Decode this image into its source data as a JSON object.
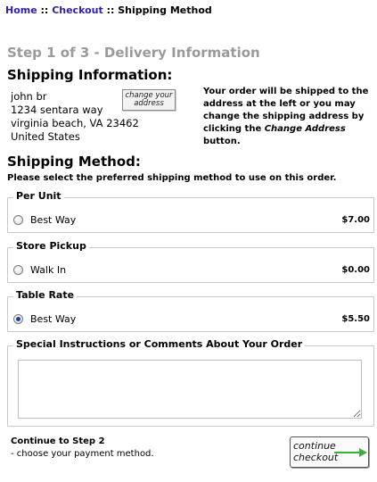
{
  "breadcrumb": {
    "home": "Home",
    "separator_1": "::",
    "checkout": "Checkout",
    "separator_2": "::",
    "current": "Shipping Method"
  },
  "step_title": "Step 1 of 3 - Delivery Information",
  "shipping_info": {
    "heading": "Shipping Information:",
    "address_lines": [
      "john br",
      "1234 sentara way",
      "virginia beach, VA 23462",
      "United States"
    ],
    "change_address_button": {
      "line1": "change your",
      "line2": "address"
    },
    "note_before": "Your order will be shipped to the address at the left or you may change the shipping address by clicking the ",
    "note_emphasis": "Change Address",
    "note_after": " button."
  },
  "shipping_method": {
    "heading": "Shipping Method:",
    "intro": "Please select the preferred shipping method to use on this order.",
    "groups": [
      {
        "title": "Per Unit",
        "option": "Best Way",
        "price": "$7.00",
        "selected": false
      },
      {
        "title": "Store Pickup",
        "option": "Walk In",
        "price": "$0.00",
        "selected": false
      },
      {
        "title": "Table Rate",
        "option": "Best Way",
        "price": "$5.50",
        "selected": true
      }
    ]
  },
  "comments": {
    "legend": "Special Instructions or Comments About Your Order",
    "value": ""
  },
  "footer": {
    "continue_title": "Continue to Step 2",
    "continue_sub": "- choose your payment method.",
    "continue_button": {
      "line1": "continue",
      "line2": "checkout"
    },
    "arrow_color": "#3fae3f"
  },
  "colors": {
    "link": "#2a1fb0",
    "step_title": "#9a9a9a",
    "fieldset_border": "#c9c9c9",
    "radio_selected": "#1b3fa8"
  }
}
